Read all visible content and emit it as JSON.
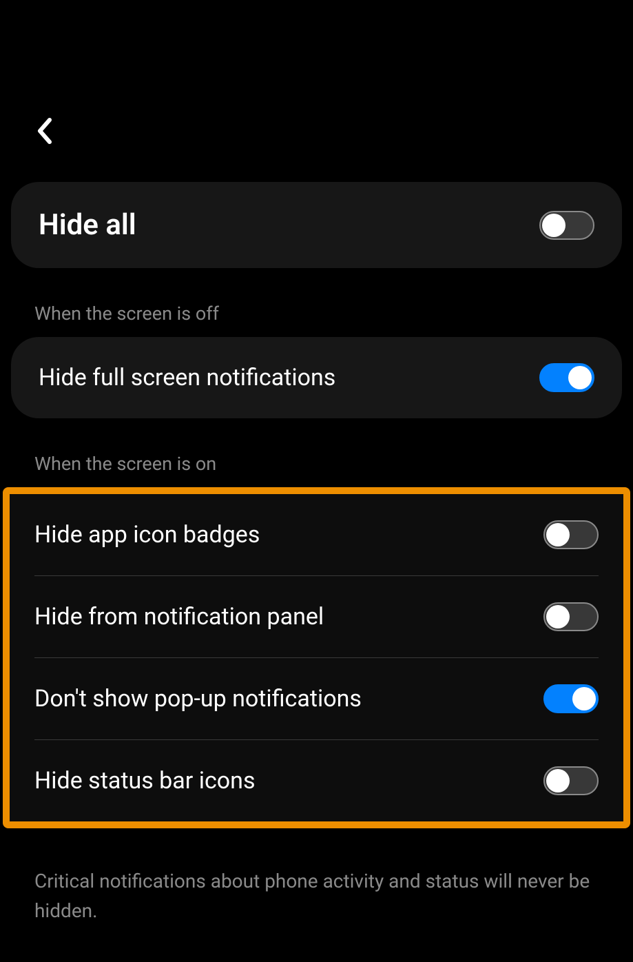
{
  "items": {
    "hide_all": {
      "label": "Hide all",
      "enabled": false
    },
    "hide_full_screen": {
      "label": "Hide full screen notifications",
      "enabled": true
    },
    "hide_badges": {
      "label": "Hide app icon badges",
      "enabled": false
    },
    "hide_panel": {
      "label": "Hide from notification panel",
      "enabled": false
    },
    "no_popup": {
      "label": "Don't show pop-up notifications",
      "enabled": true
    },
    "hide_status": {
      "label": "Hide status bar icons",
      "enabled": false
    }
  },
  "sections": {
    "screen_off": "When the screen is off",
    "screen_on": "When the screen is on"
  },
  "footer": "Critical notifications about phone activity and status will never be hidden.",
  "colors": {
    "accent": "#0381fe",
    "highlight_border": "#ed8e00"
  }
}
